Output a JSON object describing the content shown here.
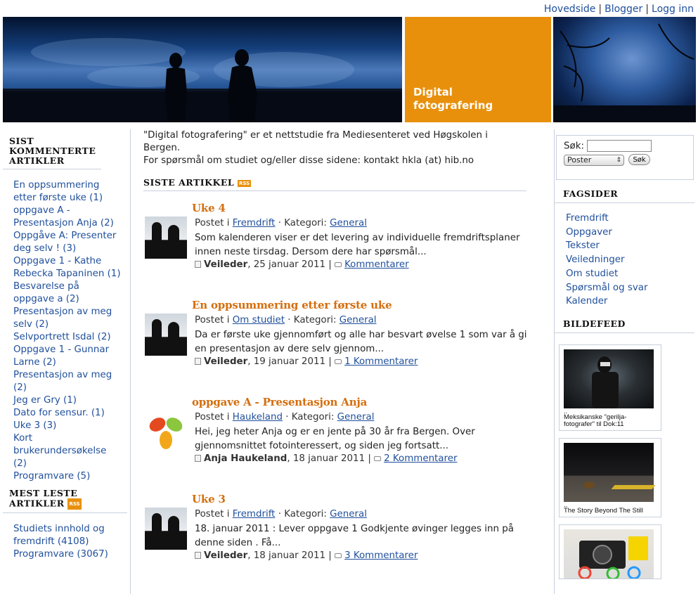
{
  "topnav": {
    "home": "Hovedside",
    "blogger": "Blogger",
    "login": "Logg inn",
    "sep": "|"
  },
  "site_title": "Digital fotografering",
  "sidebar_left": {
    "recent_comments_heading": "SIST KOMMENTERTE ARTIKLER",
    "recent_comments": [
      "En oppsummering etter første uke (1)",
      "oppgave A - Presentasjon Anja (2)",
      "Oppgåve A: Presenter deg selv ! (3)",
      "Oppgave 1 - Kathe Rebecka Tapaninen (1)",
      "Besvarelse på oppgave a (2)",
      "Presentasjon av meg selv (2)",
      "Selvportrett Isdal (2)",
      "Oppgave 1 - Gunnar Larne (2)",
      "Presentasjon av meg (2)",
      "Jeg er Gry (1)",
      "Dato for sensur. (1)",
      "Uke 3 (3)",
      "Kort brukerundersøkelse (2)",
      "Programvare (5)"
    ],
    "most_read_heading": "MEST LESTE ARTIKLER",
    "rss_label": "RSS",
    "most_read": [
      "Studiets innhold og fremdrift (4108)",
      "Programvare (3067)"
    ]
  },
  "intro": {
    "line1": "\"Digital fotografering\" er et nettstudie fra Mediesenteret ved Høgskolen i Bergen.",
    "line2": "For spørsmål om studiet og/eller disse sidene: kontakt hkla (at) hib.no"
  },
  "latest_heading": "SISTE ARTIKKEL",
  "labels": {
    "posted_in": "Postet i",
    "category": "· Kategori:"
  },
  "posts": [
    {
      "title": "Uke 4",
      "posted_in": "Fremdrift",
      "category": "General",
      "excerpt": "Som kalenderen viser er det levering av individuelle fremdriftsplaner innen neste tirsdag. Dersom dere har spørsmål...",
      "author": "Veileder",
      "date": ", 25 januar 2011",
      "comments": "Kommentarer",
      "sep": "|"
    },
    {
      "title": "En oppsummering etter første uke",
      "posted_in": "Om studiet",
      "category": "General",
      "excerpt": "Da er første uke gjennomført og alle har besvart øvelse 1 som var å gi en presentasjon av dere selv gjennom...",
      "author": "Veileder",
      "date": ", 19 januar 2011",
      "comments": "1 Kommentarer",
      "sep": "|"
    },
    {
      "title": "oppgave A - Presentasjon Anja",
      "posted_in": "Haukeland",
      "category": "General",
      "excerpt": "Hei, jeg heter Anja og er en jente på 30 år fra Bergen. Over gjennomsnittet fotointeressert, og siden jeg fortsatt...",
      "author": "Anja Haukeland",
      "date": ", 18 januar 2011",
      "comments": "2 Kommentarer",
      "sep": "|"
    },
    {
      "title": "Uke 3",
      "posted_in": "Fremdrift",
      "category": "General",
      "excerpt": "  18. januar 2011   : Lever oppgave 1   Godkjente øvinger legges inn på denne siden . Få...",
      "author": "Veileder",
      "date": ", 18 januar 2011",
      "comments": "3 Kommentarer",
      "sep": "|"
    }
  ],
  "search": {
    "label": "Søk:",
    "select_value": "Poster",
    "button": "Søk"
  },
  "fagsider": {
    "heading": "FAGSIDER",
    "items": [
      "Fremdrift",
      "Oppgaver",
      "Tekster",
      "Veiledninger",
      "Om studiet",
      "Spørsmål og svar",
      "Kalender"
    ]
  },
  "bildefeed": {
    "heading": "BILDEFEED",
    "items": [
      {
        "dots": "..",
        "caption": "Meksikanske \"gerilja­fotografer\" til Dok:11"
      },
      {
        "dots": "..",
        "caption": "The Story Beyond The Still"
      },
      {
        "dots": "",
        "caption": ""
      }
    ]
  }
}
